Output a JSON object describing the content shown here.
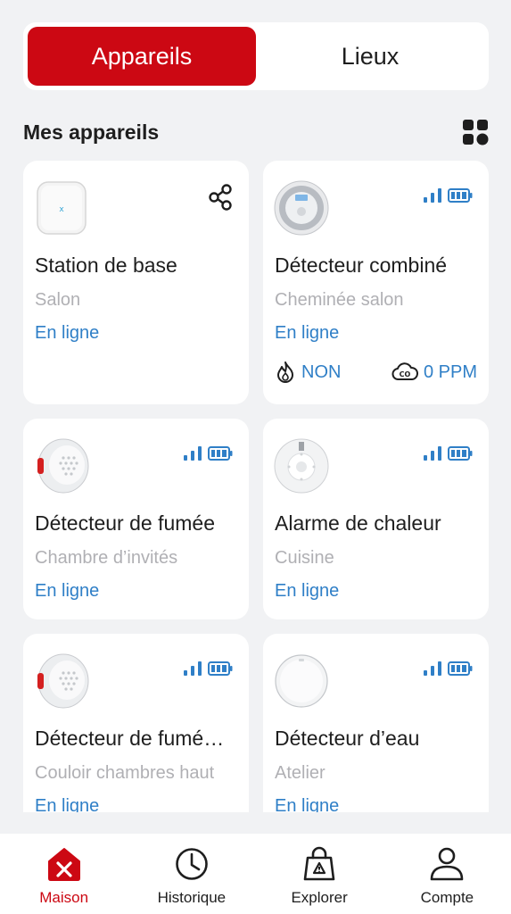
{
  "tabs": {
    "devices": "Appareils",
    "places": "Lieux"
  },
  "section": {
    "title": "Mes appareils"
  },
  "devices": [
    {
      "name": "Station de base",
      "location": "Salon",
      "status": "En ligne"
    },
    {
      "name": "Détecteur combiné",
      "location": "Cheminée salon",
      "status": "En ligne",
      "smoke_value": "NON",
      "co_value": "0 PPM"
    },
    {
      "name": "Détecteur de fumée",
      "location": "Chambre d’invités",
      "status": "En ligne"
    },
    {
      "name": "Alarme de chaleur",
      "location": "Cuisine",
      "status": "En ligne"
    },
    {
      "name": "Détecteur de fumé…",
      "location": "Couloir chambres haut",
      "status": "En ligne"
    },
    {
      "name": "Détecteur d’eau",
      "location": "Atelier",
      "status": "En ligne"
    }
  ],
  "nav": {
    "home": "Maison",
    "history": "Historique",
    "explore": "Explorer",
    "account": "Compte"
  },
  "colors": {
    "accent": "#cc0813",
    "link": "#2f7fc7",
    "background": "#f1f2f4"
  }
}
